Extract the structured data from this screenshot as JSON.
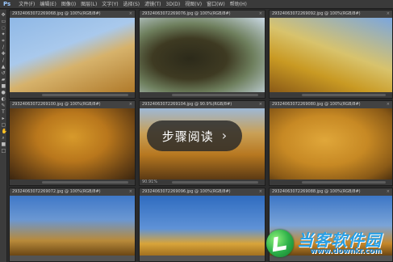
{
  "menubar": {
    "app": "Ps",
    "items": [
      "文件(F)",
      "编辑(E)",
      "图像(I)",
      "图层(L)",
      "文字(Y)",
      "选择(S)",
      "滤镜(T)",
      "3D(D)",
      "视图(V)",
      "窗口(W)",
      "帮助(H)"
    ]
  },
  "docs": [
    {
      "tab": "29324063072269068.jpg @ 100%(RGB/8#)",
      "status": ""
    },
    {
      "tab": "29324063072269076.jpg @ 100%(RGB/8#)",
      "status": ""
    },
    {
      "tab": "29324063072269092.jpg @ 100%(RGB/8#)",
      "status": ""
    },
    {
      "tab": "29324063072269100.jpg @ 100%(RGB/8#)",
      "status": ""
    },
    {
      "tab": "29324063072269104.jpg @ 90.9%(RGB/8#)",
      "status": "90.91%"
    },
    {
      "tab": "29324063072269080.jpg @ 100%(RGB/8#)",
      "status": ""
    },
    {
      "tab": "29324063072269072.jpg @ 100%(RGB/8#)",
      "status": ""
    },
    {
      "tab": "29324063072269096.jpg @ 100%(RGB/8#)",
      "status": ""
    },
    {
      "tab": "29324063072269088.jpg @ 100%(RGB/8#)",
      "status": ""
    }
  ],
  "overlay": {
    "label": "步骤阅读",
    "icon": "chevron-right-icon"
  },
  "watermark": {
    "cn": "当客软件园",
    "url": "www.downkr.com"
  }
}
